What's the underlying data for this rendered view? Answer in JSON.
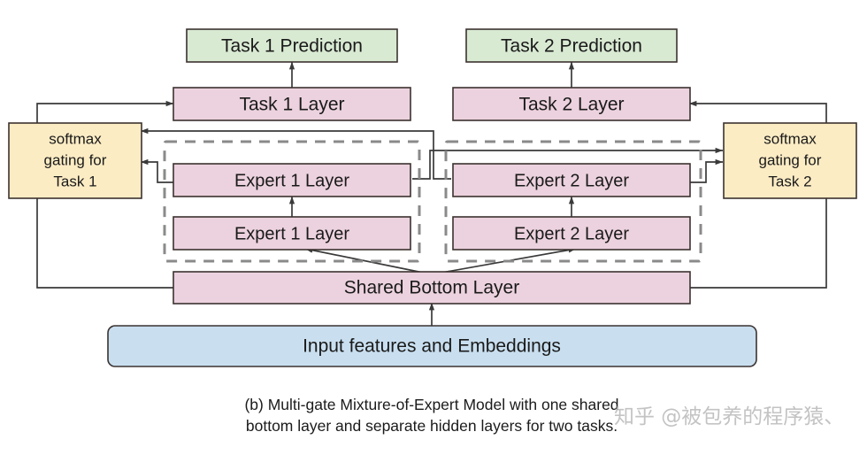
{
  "figure": {
    "caption_line1": "(b) Multi-gate Mixture-of-Expert Model with one shared",
    "caption_line2": "bottom layer and separate hidden layers for two tasks.",
    "watermark": "知乎 @被包养的程序猿、"
  },
  "colors": {
    "prediction_fill": "#d9ead3",
    "layer_fill": "#ecd2de",
    "gate_fill": "#fcecc4",
    "input_fill": "#c9dff0",
    "box_stroke": "#3b3230",
    "edge_stroke": "#3a3a3a",
    "group_dash_stroke": "#8a8a8a",
    "background": "#ffffff"
  },
  "nodes": {
    "task1_prediction": {
      "label": "Task 1 Prediction",
      "kind": "prediction"
    },
    "task2_prediction": {
      "label": "Task 2 Prediction",
      "kind": "prediction"
    },
    "task1_layer": {
      "label": "Task 1 Layer",
      "kind": "layer"
    },
    "task2_layer": {
      "label": "Task 2 Layer",
      "kind": "layer"
    },
    "gate_task1": {
      "label_line1": "softmax",
      "label_line2": "gating for",
      "label_line3": "Task 1",
      "kind": "gate"
    },
    "gate_task2": {
      "label_line1": "softmax",
      "label_line2": "gating for",
      "label_line3": "Task 2",
      "kind": "gate"
    },
    "expert1_upper": {
      "label": "Expert 1 Layer",
      "kind": "layer"
    },
    "expert1_lower": {
      "label": "Expert 1 Layer",
      "kind": "layer"
    },
    "expert2_upper": {
      "label": "Expert 2 Layer",
      "kind": "layer"
    },
    "expert2_lower": {
      "label": "Expert 2 Layer",
      "kind": "layer"
    },
    "shared_bottom": {
      "label": "Shared Bottom Layer",
      "kind": "layer"
    },
    "input_features": {
      "label": "Input features and Embeddings",
      "kind": "input"
    }
  },
  "groups": {
    "expert1_group": {
      "name": "expert-1-tower-group"
    },
    "expert2_group": {
      "name": "expert-2-tower-group"
    }
  }
}
